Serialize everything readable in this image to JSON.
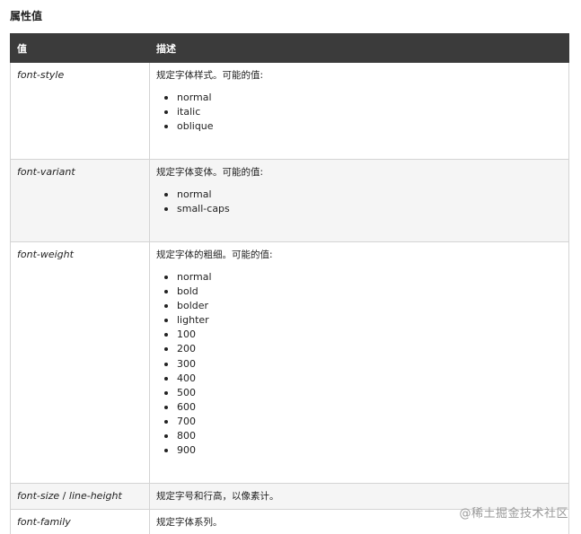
{
  "section_title": "属性值",
  "table": {
    "headers": [
      "值",
      "描述"
    ],
    "rows": [
      {
        "value": "font-style",
        "desc": "规定字体样式。可能的值:",
        "options": [
          "normal",
          "italic",
          "oblique"
        ]
      },
      {
        "value": "font-variant",
        "desc": "规定字体变体。可能的值:",
        "options": [
          "normal",
          "small-caps"
        ]
      },
      {
        "value": "font-weight",
        "desc": "规定字体的粗细。可能的值:",
        "options": [
          "normal",
          "bold",
          "bolder",
          "lighter",
          "100",
          "200",
          "300",
          "400",
          "500",
          "600",
          "700",
          "800",
          "900"
        ]
      },
      {
        "value_parts": [
          "font-size",
          " / ",
          "line-height"
        ],
        "desc": "规定字号和行高，以像素计。",
        "options": []
      },
      {
        "value": "font-family",
        "desc": "规定字体系列。",
        "options": []
      }
    ]
  },
  "watermark": "@稀土掘金技术社区"
}
